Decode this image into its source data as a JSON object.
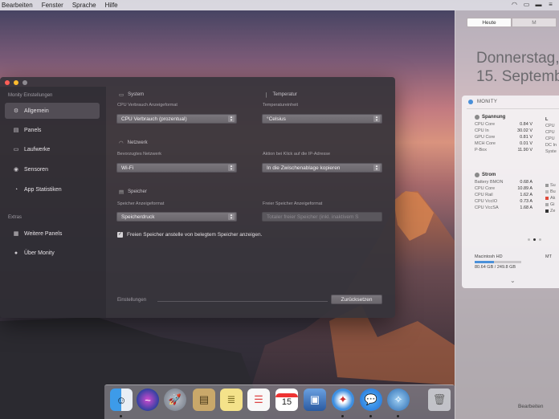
{
  "menubar": {
    "items": [
      "Bearbeiten",
      "Fenster",
      "Sprache",
      "Hilfe"
    ]
  },
  "notification_center": {
    "tabs": [
      "Heute",
      "M"
    ],
    "date_line1": "Donnerstag,",
    "date_line2": "15. Septemb",
    "widget_title": "MONITY",
    "spannung": {
      "title": "Spannung",
      "rows": [
        {
          "label": "CPU Core",
          "value": "0.84 V"
        },
        {
          "label": "CPU In",
          "value": "30.02 V"
        },
        {
          "label": "GPU Core",
          "value": "0.81 V"
        },
        {
          "label": "MCH Core",
          "value": "0.01 V"
        },
        {
          "label": "P-Box",
          "value": "11.90 V"
        }
      ]
    },
    "strom": {
      "title": "Strom",
      "rows": [
        {
          "label": "Battery BMON",
          "value": "0.68 A"
        },
        {
          "label": "CPU Core",
          "value": "10.89 A"
        },
        {
          "label": "CPU Rail",
          "value": "1.62 A"
        },
        {
          "label": "CPU VccIO",
          "value": "0.73 A"
        },
        {
          "label": "CPU VccSA",
          "value": "1.68 A"
        }
      ]
    },
    "right_col1": [
      "L",
      "CPU",
      "CPU",
      "CPU",
      "DC In",
      "Syste"
    ],
    "right_col2": [
      "",
      "Su",
      "Bu",
      "Ak",
      "Gi",
      "Ze"
    ],
    "disk_name": "Macintosh HD",
    "disk_usage": "80.64 GB / 249.8 GB",
    "disk_fraction": 0.42,
    "disk2_name": "MT",
    "edit_label": "Bearbeiten"
  },
  "window": {
    "sidebar": {
      "heading": "Monity Einstellungen",
      "items": [
        {
          "label": "Allgemein",
          "icon": "gear-icon"
        },
        {
          "label": "Panels",
          "icon": "panels-icon"
        },
        {
          "label": "Laufwerke",
          "icon": "drive-icon"
        },
        {
          "label": "Sensoren",
          "icon": "sensor-icon"
        },
        {
          "label": "App Statistiken",
          "icon": "stats-icon"
        }
      ],
      "extras_heading": "Extras",
      "extras": [
        {
          "label": "Weitere Panels",
          "icon": "more-panels-icon"
        },
        {
          "label": "Über Monity",
          "icon": "info-icon"
        }
      ]
    },
    "system": {
      "title": "System",
      "cpu_label": "CPU Verbrauch Anzeigeformat",
      "cpu_value": "CPU Verbrauch (prozentual)"
    },
    "temperature": {
      "title": "Temperatur",
      "unit_label": "Temperatureinheit",
      "unit_value": "°Celsius"
    },
    "network": {
      "title": "Netzwerk",
      "pref_label": "Bevorzugtes Netzwerk",
      "pref_value": "Wi-Fi",
      "action_label": "Aktion bei Klick auf die IP-Adresse",
      "action_value": "In die Zwischenablage kopieren"
    },
    "storage": {
      "title": "Speicher",
      "format_label": "Speicher Anzeigeformat",
      "format_value": "Speicherdruck",
      "free_label": "Freier Speicher Anzeigeformat",
      "free_value": "Totaler freier Speicher (inkl. inaktivem S",
      "checkbox_label": "Freien Speicher anstelle von belegtem Speicher anzeigen."
    },
    "footer_label": "Einstellungen",
    "reset_button": "Zurücksetzen"
  },
  "dock": {
    "icons": [
      "finder-icon",
      "siri-icon",
      "launchpad-icon",
      "notes-icon",
      "stickies-icon",
      "reminders-icon",
      "calendar-icon",
      "preview-icon",
      "safari-icon",
      "messages-icon",
      "network-utility-icon",
      "trash-icon"
    ],
    "calendar_day": "15"
  },
  "colors": {
    "accent": "#4a90d9",
    "close": "#ff5f57",
    "minimize": "#febc2e",
    "zoom": "#8e8b91"
  }
}
